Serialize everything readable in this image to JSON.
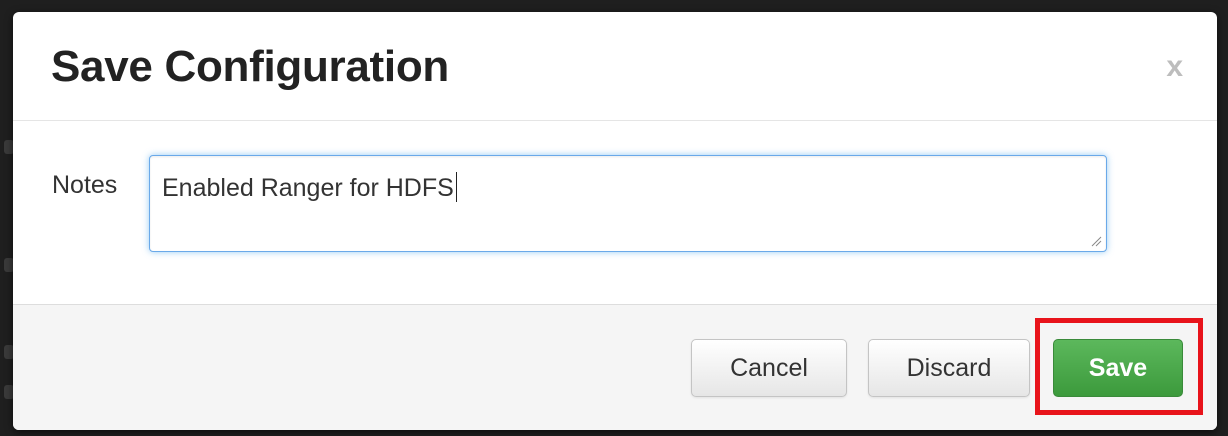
{
  "dialog": {
    "title": "Save Configuration",
    "close_label": "x"
  },
  "notes": {
    "label": "Notes",
    "value": "Enabled Ranger for HDFS"
  },
  "footer": {
    "cancel_label": "Cancel",
    "discard_label": "Discard",
    "save_label": "Save"
  },
  "colors": {
    "save_button": "#4cae4c",
    "highlight": "#e8141b",
    "focus_border": "#6aa9e9"
  },
  "icons": {
    "close": "close-icon",
    "resize": "resize-grip-icon"
  }
}
